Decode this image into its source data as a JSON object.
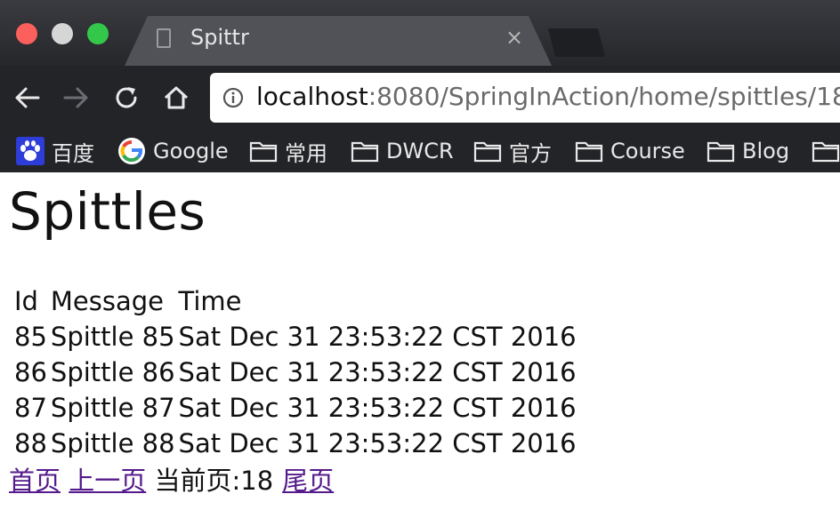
{
  "browser": {
    "tab": {
      "title": "Spittr",
      "close_glyph": "×"
    },
    "url": {
      "host": "localhost",
      "rest": ":8080/SpringInAction/home/spittles/18"
    },
    "bookmarks": [
      {
        "label": "百度",
        "icon": "baidu-paw-icon"
      },
      {
        "label": "Google",
        "icon": "google-g-icon"
      },
      {
        "label": "常用",
        "icon": "folder-icon"
      },
      {
        "label": "DWCR",
        "icon": "folder-icon"
      },
      {
        "label": "官方",
        "icon": "folder-icon"
      },
      {
        "label": "Course",
        "icon": "folder-icon"
      },
      {
        "label": "Blog",
        "icon": "folder-icon"
      }
    ]
  },
  "page": {
    "title": "Spittles",
    "table": {
      "headers": {
        "id": "Id",
        "message": "Message",
        "time": "Time"
      },
      "rows": [
        {
          "id": "85",
          "message": "Spittle 85",
          "time": "Sat Dec 31 23:53:22 CST 2016"
        },
        {
          "id": "86",
          "message": "Spittle 86",
          "time": "Sat Dec 31 23:53:22 CST 2016"
        },
        {
          "id": "87",
          "message": "Spittle 87",
          "time": "Sat Dec 31 23:53:22 CST 2016"
        },
        {
          "id": "88",
          "message": "Spittle 88",
          "time": "Sat Dec 31 23:53:22 CST 2016"
        }
      ]
    },
    "pager": {
      "first": "首页",
      "prev": "上一页",
      "current": "当前页:18",
      "last": "尾页"
    }
  },
  "colors": {
    "link_visited": "#551a8b",
    "chrome_dark": "#232428",
    "tab_active": "#505258"
  }
}
